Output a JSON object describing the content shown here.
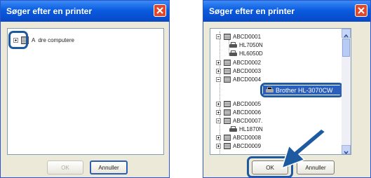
{
  "dialog_title": "Søger efter en printer",
  "left_dialog": {
    "tree_item_label": "Andre computere",
    "tree_item_prefix": "A",
    "tree_item_rest": "dre computere",
    "ok_label": "OK",
    "cancel_label": "Annuller"
  },
  "right_dialog": {
    "tree_items": [
      {
        "label": "ABCD0001",
        "type": "computer",
        "expander": "minus"
      },
      {
        "label": "HL7050N",
        "type": "printer"
      },
      {
        "label": "HL6050D",
        "type": "printer"
      },
      {
        "label": "ABCD0002",
        "type": "computer",
        "expander": "plus"
      },
      {
        "label": "ABCD0003",
        "type": "computer",
        "expander": "plus"
      },
      {
        "label": "ABCD0004",
        "type": "computer",
        "expander": "minus"
      },
      {
        "label": "Brother HL-3070CW",
        "type": "printer",
        "selected": true
      },
      {
        "label": "ABCD0005",
        "type": "computer",
        "expander": "plus"
      },
      {
        "label": "ABCD0006",
        "type": "computer",
        "expander": "plus"
      },
      {
        "label": "ABCD0007.",
        "type": "computer",
        "expander": "minus"
      },
      {
        "label": "HL1870N",
        "type": "printer"
      },
      {
        "label": "ABCD0008",
        "type": "computer",
        "expander": "plus"
      },
      {
        "label": "ABCD0009",
        "type": "computer",
        "expander": "plus"
      }
    ],
    "ok_label": "OK",
    "cancel_label": "Annuller"
  },
  "colors": {
    "titlebar": "#0a5be0",
    "close_button": "#e2462b",
    "highlight_ring": "#1d5aa0",
    "selection": "#2b5fbd"
  }
}
